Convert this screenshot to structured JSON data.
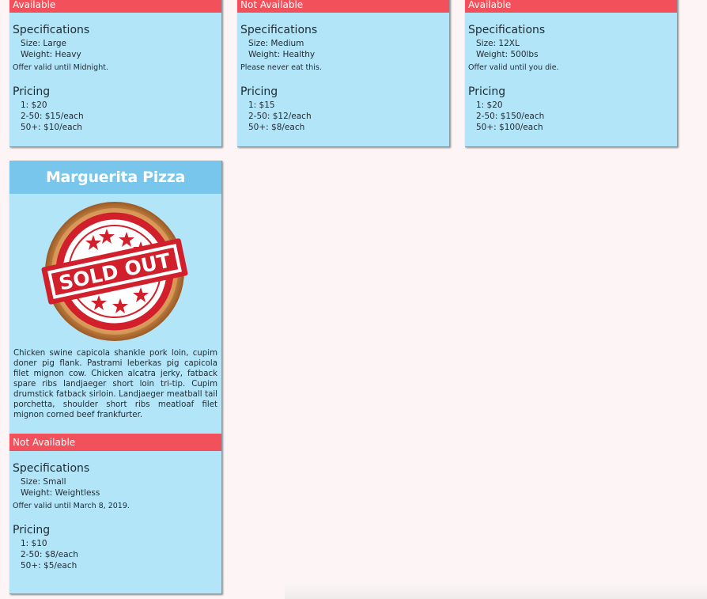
{
  "cards": [
    {
      "status": "Available",
      "spec_title": "Specifications",
      "size": "Size: Large",
      "weight": "Weight: Heavy",
      "offer": "Offer valid until Midnight.",
      "pricing_title": "Pricing",
      "p1": "1: $20",
      "p2": "2-50: $15/each",
      "p3": "50+: $10/each"
    },
    {
      "status": "Not Available",
      "spec_title": "Specifications",
      "size": "Size: Medium",
      "weight": "Weight: Healthy",
      "offer": "Please never eat this.",
      "pricing_title": "Pricing",
      "p1": "1: $15",
      "p2": "2-50: $12/each",
      "p3": "50+: $8/each"
    },
    {
      "status": "Available",
      "spec_title": "Specifications",
      "size": "Size: 12XL",
      "weight": "Weight: 500lbs",
      "offer": "Offer valid until you die.",
      "pricing_title": "Pricing",
      "p1": "1: $20",
      "p2": "2-50: $150/each",
      "p3": "50+: $100/each"
    },
    {
      "title": "Marguerita Pizza",
      "stamp_text": "SOLD OUT",
      "description": "Chicken swine capicola shankle pork loin, cupim doner pig flank. Pastrami leberkas pig capicola filet mignon cow. Chicken alcatra jerky, fatback spare ribs landjaeger short loin tri-tip. Cupim drumstick fatback sirloin. Landjaeger meatball tail porchetta, shoulder short ribs meatloaf filet mignon corned beef frankfurter.",
      "status": "Not Available",
      "spec_title": "Specifications",
      "size": "Size: Small",
      "weight": "Weight: Weightless",
      "offer": "Offer valid until March 8, 2019.",
      "pricing_title": "Pricing",
      "p1": "1: $10",
      "p2": "2-50: $8/each",
      "p3": "50+: $5/each"
    }
  ],
  "colors": {
    "page_bg": "#fdf5f5",
    "card_bg": "#b3e5f9",
    "status_bar": "#f2505a",
    "title_bar": "#78c6eb",
    "stamp_red": "#d11f2c"
  }
}
